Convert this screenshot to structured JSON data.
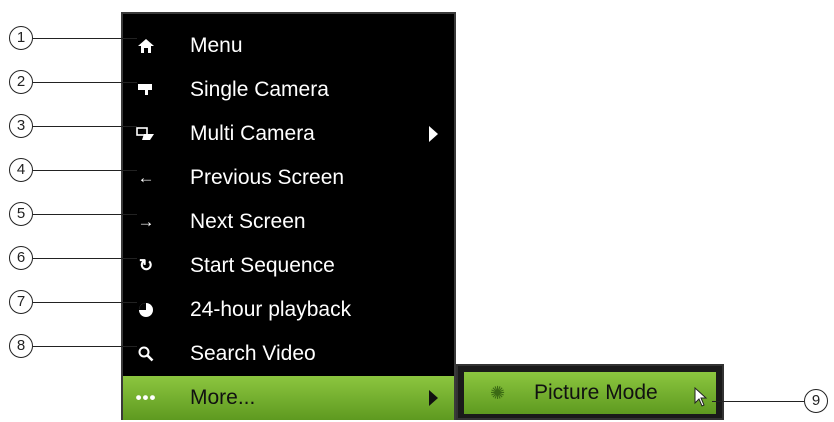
{
  "menu": {
    "items": [
      {
        "label": "Menu",
        "icon": "home-icon",
        "glyph": "⌂",
        "callout": "1"
      },
      {
        "label": "Single Camera",
        "icon": "camera-icon",
        "glyph": "▀",
        "callout": "2"
      },
      {
        "label": "Multi Camera",
        "icon": "multi-camera-icon",
        "glyph": "⊞",
        "callout": "3",
        "has_submenu": true
      },
      {
        "label": "Previous Screen",
        "icon": "arrow-left-icon",
        "glyph": "←",
        "callout": "4"
      },
      {
        "label": "Next Screen",
        "icon": "arrow-right-icon",
        "glyph": "→",
        "callout": "5"
      },
      {
        "label": "Start Sequence",
        "icon": "refresh-icon",
        "glyph": "↻",
        "callout": "6"
      },
      {
        "label": "24-hour playback",
        "icon": "playback-icon",
        "glyph": "◕",
        "callout": "7"
      },
      {
        "label": "Search Video",
        "icon": "search-icon",
        "glyph": "⚲",
        "callout": "8"
      },
      {
        "label": "More...",
        "icon": "more-icon",
        "glyph": "•••",
        "has_submenu": true,
        "selected": true
      }
    ]
  },
  "submenu": {
    "items": [
      {
        "label": "Picture Mode",
        "icon": "picture-mode-icon",
        "glyph": "✺",
        "callout": "9"
      }
    ]
  },
  "colors": {
    "menu_bg": "#000000",
    "highlight": "#8cc63f",
    "text": "#ffffff"
  }
}
